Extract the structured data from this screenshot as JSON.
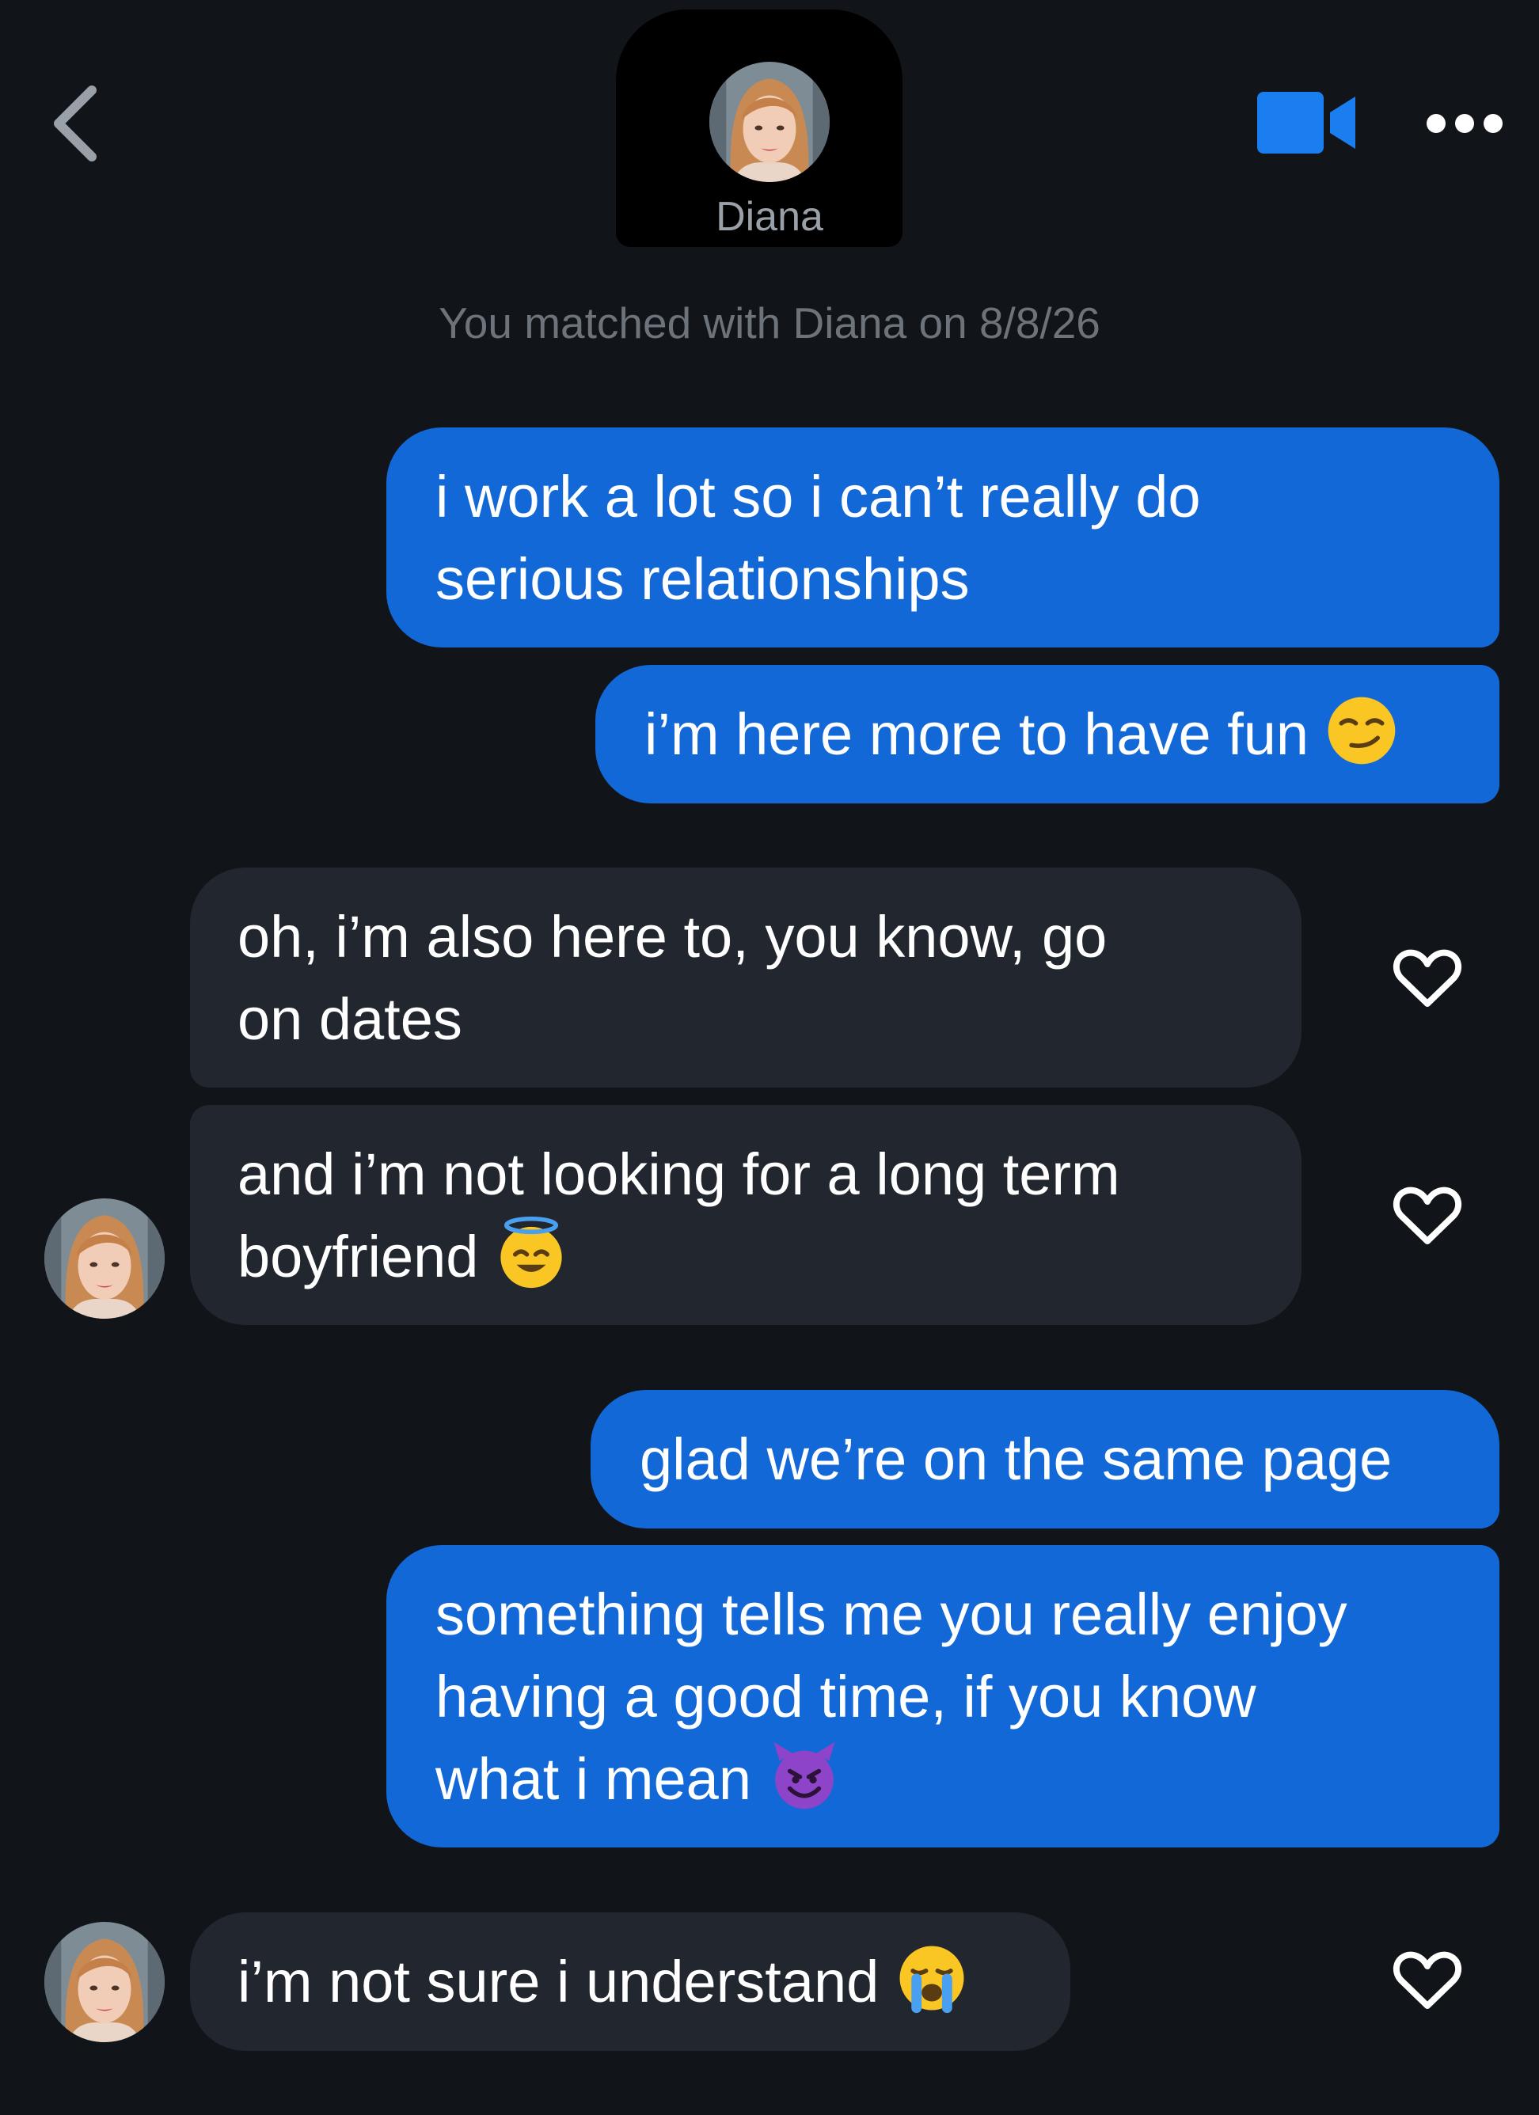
{
  "header": {
    "contact_name": "Diana",
    "back_icon": "chevron-left-icon",
    "video_icon": "video-camera-icon",
    "more_icon": "more-dots-icon",
    "accent_color": "#1a7ef0"
  },
  "match_notice": "You matched with Diana on 8/8/26",
  "messages": [
    {
      "sender": "me",
      "lines": [
        "i work a lot so i can’t really do",
        "serious relationships"
      ]
    },
    {
      "sender": "me",
      "lines": [
        "i’m here more to have fun"
      ],
      "emoji": "smirking-face-emoji"
    },
    {
      "sender": "Diana",
      "lines": [
        "oh, i’m also here to, you know, go",
        "on dates"
      ],
      "liked": false
    },
    {
      "sender": "Diana",
      "lines": [
        "and i’m not looking for a long term",
        "boyfriend"
      ],
      "emoji": "halo-smiling-face-emoji",
      "liked": false
    },
    {
      "sender": "me",
      "lines": [
        "glad we’re on the same page"
      ]
    },
    {
      "sender": "me",
      "lines": [
        "something tells me you really enjoy",
        "having a good time, if you know",
        "what i mean"
      ],
      "emoji": "smiling-devil-face-emoji"
    },
    {
      "sender": "Diana",
      "lines": [
        "i’m not sure i understand"
      ],
      "emoji": "crying-face-emoji",
      "liked": false
    }
  ],
  "colors": {
    "background": "#111418",
    "sent_bubble": "#1368d8",
    "received_bubble": "#22262e",
    "text": "#ffffff",
    "muted_text": "#6d737b"
  }
}
